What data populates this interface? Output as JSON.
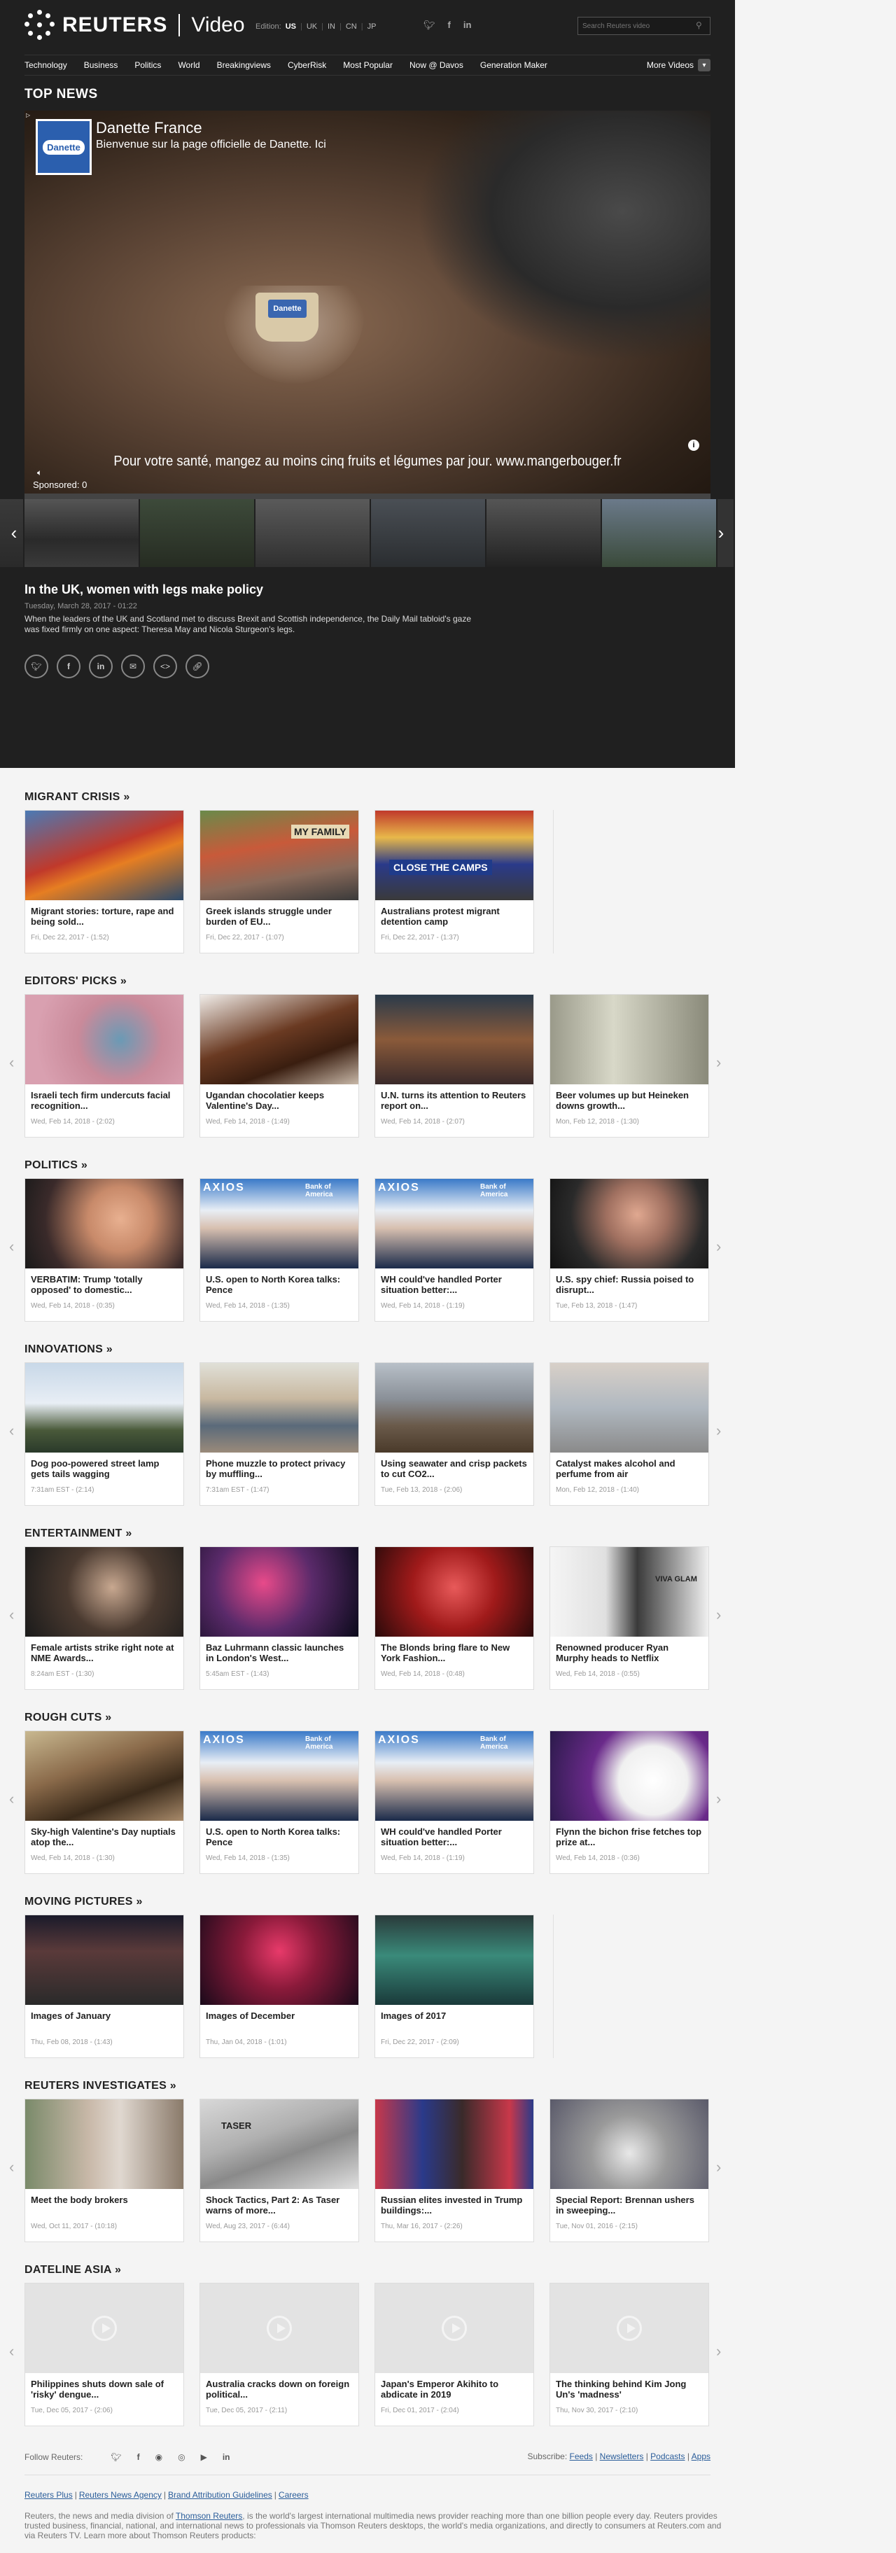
{
  "header": {
    "brand": "REUTERS",
    "section": "Video",
    "edition_label": "Edition:",
    "editions": [
      "US",
      "UK",
      "IN",
      "CN",
      "JP"
    ],
    "selected_edition": "US",
    "search_placeholder": "Search Reuters video"
  },
  "nav": {
    "items": [
      "Technology",
      "Business",
      "Politics",
      "World",
      "Breakingviews",
      "CyberRisk",
      "Most Popular",
      "Now @ Davos",
      "Generation Maker"
    ],
    "more": "More Videos"
  },
  "top_news": {
    "label": "TOP NEWS",
    "ad": {
      "logo_text": "Danette",
      "title": "Danette France",
      "subtitle": "Bienvenue sur la page officielle de Danette. Ici",
      "caption": "Pour votre santé, mangez au moins cinq fruits et légumes par jour. www.mangerbouger.fr",
      "sponsored": "Sponsored: 0",
      "progress": 0.0
    },
    "headline": "In the UK, women with legs make policy",
    "date": "Tuesday, March 28, 2017 - 01:22",
    "summary": "When the leaders of the UK and Scotland met to discuss Brexit and Scottish independence, the Daily Mail tabloid's gaze was fixed firmly on one aspect: Theresa May and Nicola Sturgeon's legs."
  },
  "sections": [
    {
      "title": "MIGRANT CRISIS »",
      "cards": [
        {
          "title": "Migrant stories: torture, rape and being sold...",
          "meta": "Fri, Dec 22, 2017 - (1:52)"
        },
        {
          "title": "Greek islands struggle under burden of EU...",
          "meta": "Fri, Dec 22, 2017 - (1:07)"
        },
        {
          "title": "Australians protest migrant detention camp",
          "meta": "Fri, Dec 22, 2017 - (1:37)"
        }
      ]
    },
    {
      "title": "EDITORS' PICKS »",
      "cards": [
        {
          "title": "Israeli tech firm undercuts facial recognition...",
          "meta": "Wed, Feb 14, 2018 - (2:02)"
        },
        {
          "title": "Ugandan chocolatier keeps Valentine's Day...",
          "meta": "Wed, Feb 14, 2018 - (1:49)"
        },
        {
          "title": "U.N. turns its attention to Reuters report on...",
          "meta": "Wed, Feb 14, 2018 - (2:07)"
        },
        {
          "title": "Beer volumes up but Heineken downs growth...",
          "meta": "Mon, Feb 12, 2018 - (1:30)"
        }
      ]
    },
    {
      "title": "POLITICS »",
      "cards": [
        {
          "title": "VERBATIM: Trump 'totally opposed' to domestic...",
          "meta": "Wed, Feb 14, 2018 - (0:35)"
        },
        {
          "title": "U.S. open to North Korea talks: Pence",
          "meta": "Wed, Feb 14, 2018 - (1:35)"
        },
        {
          "title": "WH could've handled Porter situation better:...",
          "meta": "Wed, Feb 14, 2018 - (1:19)"
        },
        {
          "title": "U.S. spy chief: Russia poised to disrupt...",
          "meta": "Tue, Feb 13, 2018 - (1:47)"
        }
      ]
    },
    {
      "title": "INNOVATIONS »",
      "cards": [
        {
          "title": "Dog poo-powered street lamp gets tails wagging",
          "meta": "7:31am EST - (2:14)"
        },
        {
          "title": "Phone muzzle to protect privacy by muffling...",
          "meta": "7:31am EST - (1:47)"
        },
        {
          "title": "Using seawater and crisp packets to cut CO2...",
          "meta": "Tue, Feb 13, 2018 - (2:06)"
        },
        {
          "title": "Catalyst makes alcohol and perfume from air",
          "meta": "Mon, Feb 12, 2018 - (1:40)"
        }
      ]
    },
    {
      "title": "ENTERTAINMENT »",
      "cards": [
        {
          "title": "Female artists strike right note at NME Awards...",
          "meta": "8:24am EST - (1:30)"
        },
        {
          "title": "Baz Luhrmann classic launches in London's West...",
          "meta": "5:45am EST - (1:43)"
        },
        {
          "title": "The Blonds bring flare to New York Fashion...",
          "meta": "Wed, Feb 14, 2018 - (0:48)"
        },
        {
          "title": "Renowned producer Ryan Murphy heads to Netflix",
          "meta": "Wed, Feb 14, 2018 - (0:55)"
        }
      ]
    },
    {
      "title": "ROUGH CUTS »",
      "cards": [
        {
          "title": "Sky-high Valentine's Day nuptials atop the...",
          "meta": "Wed, Feb 14, 2018 - (1:30)"
        },
        {
          "title": "U.S. open to North Korea talks: Pence",
          "meta": "Wed, Feb 14, 2018 - (1:35)"
        },
        {
          "title": "WH could've handled Porter situation better:...",
          "meta": "Wed, Feb 14, 2018 - (1:19)"
        },
        {
          "title": "Flynn the bichon frise fetches top prize at...",
          "meta": "Wed, Feb 14, 2018 - (0:36)"
        }
      ]
    },
    {
      "title": "MOVING PICTURES »",
      "cards": [
        {
          "title": "Images of January",
          "meta": "Thu, Feb 08, 2018 - (1:43)"
        },
        {
          "title": "Images of December",
          "meta": "Thu, Jan 04, 2018 - (1:01)"
        },
        {
          "title": "Images of 2017",
          "meta": "Fri, Dec 22, 2017 - (2:09)"
        }
      ]
    },
    {
      "title": "REUTERS INVESTIGATES »",
      "cards": [
        {
          "title": "Meet the body brokers",
          "meta": "Wed, Oct 11, 2017 - (10:18)"
        },
        {
          "title": "Shock Tactics, Part 2: As Taser warns of more...",
          "meta": "Wed, Aug 23, 2017 - (6:44)"
        },
        {
          "title": "Russian elites invested in Trump buildings:...",
          "meta": "Thu, Mar 16, 2017 - (2:26)"
        },
        {
          "title": "Special Report: Brennan ushers in sweeping...",
          "meta": "Tue, Nov 01, 2016 - (2:15)"
        }
      ]
    },
    {
      "title": "DATELINE ASIA »",
      "cards": [
        {
          "title": "Philippines shuts down sale of 'risky' dengue...",
          "meta": "Tue, Dec 05, 2017 - (2:06)"
        },
        {
          "title": "Australia cracks down on foreign political...",
          "meta": "Tue, Dec 05, 2017 - (2:11)"
        },
        {
          "title": "Japan's Emperor Akihito to abdicate in 2019",
          "meta": "Fri, Dec 01, 2017 - (2:04)"
        },
        {
          "title": "The thinking behind Kim Jong Un's 'madness'",
          "meta": "Thu, Nov 30, 2017 - (2:10)"
        }
      ]
    }
  ],
  "thumb_text": {
    "family": "MY FAMILY",
    "camps": "CLOSE THE CAMPS",
    "axios": "AXIOS",
    "boa": "Bank of America",
    "viva": "VIVA GLAM",
    "taser": "TASER"
  },
  "footer": {
    "follow_label": "Follow Reuters:",
    "subscribe_label": "Subscribe:",
    "subscribe_links": [
      "Feeds",
      "Newsletters",
      "Podcasts",
      "Apps"
    ],
    "links": [
      "Reuters Plus",
      "Reuters News Agency",
      "Brand Attribution Guidelines",
      "Careers"
    ],
    "text_before": "Reuters, the news and media division of",
    "text_link": "Thomson Reuters",
    "text_after": ", is the world's largest international multimedia news provider reaching more than one billion people every day. Reuters provides trusted business, financial, national, and international news to professionals via Thomson Reuters desktops, the world's media organizations, and directly to consumers at Reuters.com and via Reuters TV. Learn more about Thomson Reuters products:"
  }
}
